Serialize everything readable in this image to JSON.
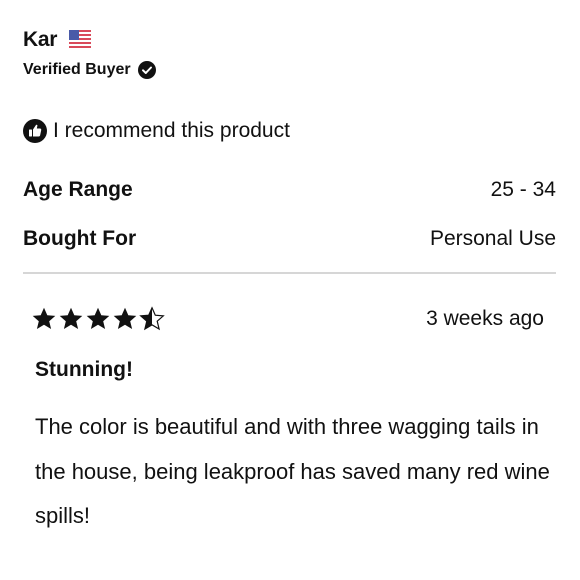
{
  "reviewer": {
    "name": "Kar",
    "flag_icon": "us-flag-icon",
    "verified_label": "Verified Buyer",
    "verified_icon": "checkmark-badge-icon"
  },
  "recommendation": {
    "icon": "thumbs-up-icon",
    "text": "I recommend this product"
  },
  "attributes": [
    {
      "label": "Age Range",
      "value": "25 - 34"
    },
    {
      "label": "Bought For",
      "value": "Personal Use"
    }
  ],
  "review": {
    "rating": 4.5,
    "max_rating": 5,
    "date": "3 weeks ago",
    "title": "Stunning!",
    "body": "The color is beautiful and with three wagging tails in the house, being leakproof has saved many red wine spills!"
  },
  "colors": {
    "text": "#111111",
    "divider": "#d6d6d6",
    "star": "#111111"
  }
}
